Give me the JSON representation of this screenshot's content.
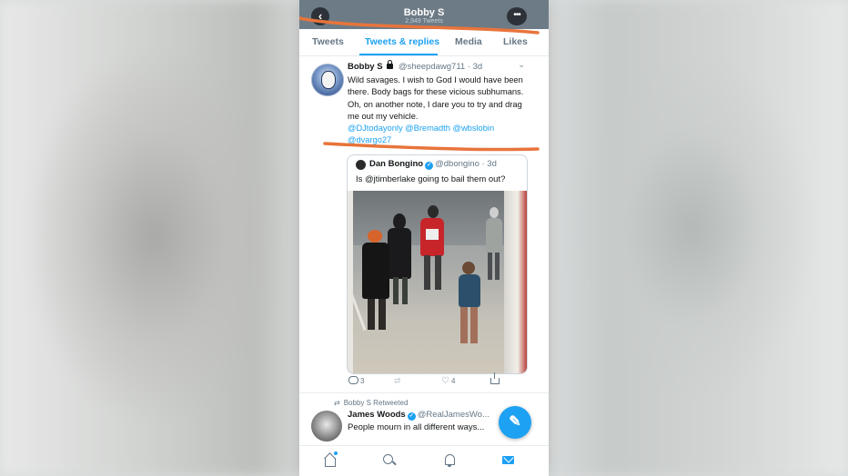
{
  "profile": {
    "name": "Bobby S",
    "tweet_count": "2,949 Tweets",
    "back_icon": "chevron-left-icon",
    "more_icon": "more-icon"
  },
  "tabs": [
    {
      "label": "Tweets",
      "active": false
    },
    {
      "label": "Tweets & replies",
      "active": true
    },
    {
      "label": "Media",
      "active": false
    },
    {
      "label": "Likes",
      "active": false
    }
  ],
  "colors": {
    "accent": "#1da1f2",
    "annotation": "#e8743b",
    "header": "#6d7b86"
  },
  "tweet": {
    "name": "Bobby S",
    "handle": "@sheepdawg711",
    "time": "· 3d",
    "text": "Wild savages. I wish to God I would have been there.  Body bags for these vicious subhumans. Oh, on another note,  I dare you to try and drag me out my vehicle.",
    "mentions_line1": "@DJtodayonly @Bremadth @wbslobin",
    "mentions_line2": "@dvargo27",
    "replies": "3",
    "likes": "4"
  },
  "quoted": {
    "name": "Dan Bongino",
    "handle": "@dbongino",
    "time": "· 3d",
    "text": "Is @jtimberlake going to bail them out?"
  },
  "retweet": {
    "label": "Bobby S Retweeted",
    "name": "James Woods",
    "handle": "@RealJamesWo...",
    "text": "People mourn in all different ways..."
  },
  "fab_icon": "compose-tweet-icon",
  "bottom_nav": [
    "home-icon",
    "search-icon",
    "bell-icon",
    "mail-icon"
  ]
}
